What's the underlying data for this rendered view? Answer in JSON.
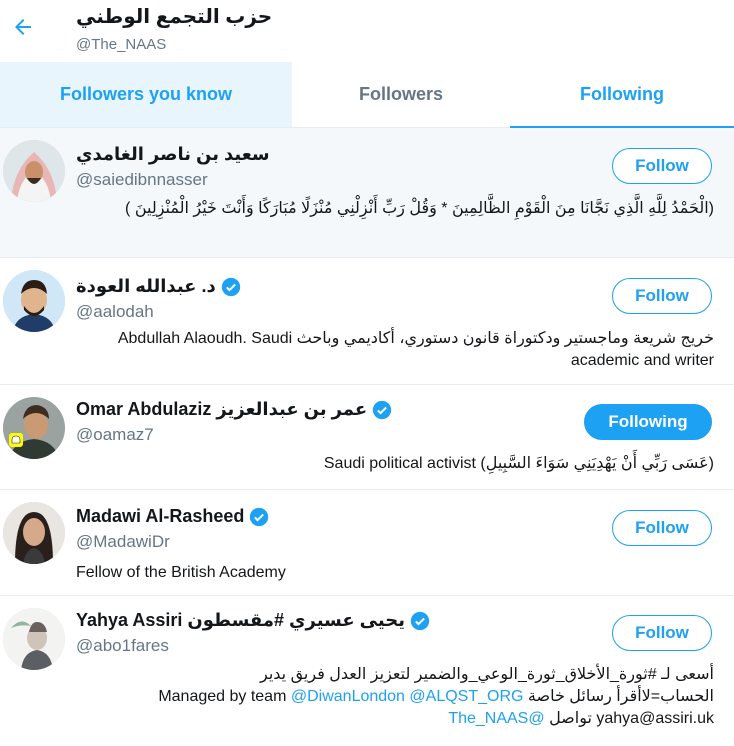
{
  "header": {
    "title": "حزب التجمع الوطني",
    "handle": "@The_NAAS",
    "back_icon": "arrow-left-icon"
  },
  "tabs": [
    {
      "label": "Followers you know"
    },
    {
      "label": "Followers"
    },
    {
      "label": "Following"
    }
  ],
  "colors": {
    "accent": "#1da1f2",
    "muted": "#657786",
    "highlight_bg": "#f5f8fa"
  },
  "users": [
    {
      "name": "سعيد بن ناصر الغامدي",
      "handle": "@saiedibnnasser",
      "bio": "(الْحَمْدُ لِلَّهِ الَّذِي نَجَّانَا مِنَ الْقَوْمِ الظَّالِمِينَ * وَقُلْ رَبِّ أَنْزِلْنِي مُنْزَلًا مُبَارَكًا وَأَنْتَ خَيْرُ الْمُنْزِلِينَ )",
      "button": "Follow"
    },
    {
      "name": "د. عبدالله العودة",
      "handle": "@aalodah",
      "bio": "خريج شريعة وماجستير ودكتوراة قانون دستوري، أكاديمي وباحث Abdullah Alaoudh. Saudi academic and writer",
      "button": "Follow"
    },
    {
      "name": "Omar Abdulaziz عمر بن عبدالعزيز",
      "handle": "@oamaz7",
      "bio": "(عَسَى رَبِّي أَنْ يَهْدِيَنِي سَوَاءَ السَّبِيلِ) Saudi political activist",
      "button": "Following"
    },
    {
      "name": "Madawi Al-Rasheed",
      "handle": "@MadawiDr",
      "bio": "Fellow of the British Academy",
      "button": "Follow"
    },
    {
      "name": "Yahya Assiri يحيى عسيري #مقسطون",
      "handle": "@abo1fares",
      "bio_line1": "أسعى لـ #ثورة_الأخلاق_ثورة_الوعي_والضمير لتعزيز العدل فريق يدير",
      "bio_line2_text": "الحساب=لاأقرأ رسائل خاصة Managed by team",
      "bio_line2_links": "@DiwanLondon @ALQST_ORG",
      "bio_line3_text": "yahya@assiri.uk تواصل",
      "bio_line3_link": "@The_NAAS",
      "button": "Follow"
    }
  ]
}
